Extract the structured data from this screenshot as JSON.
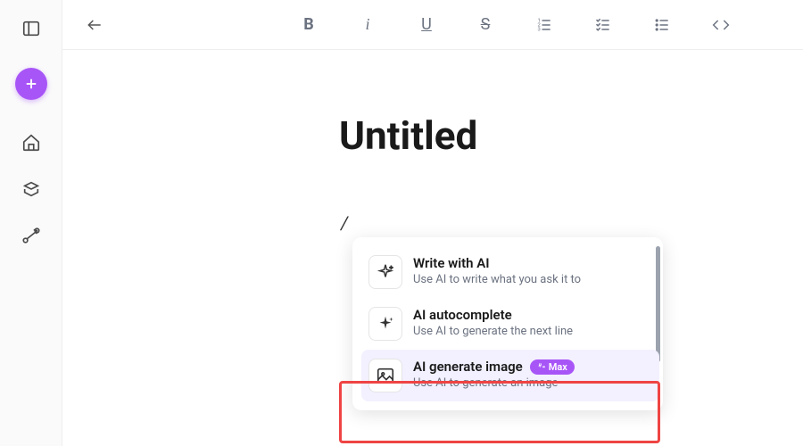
{
  "document": {
    "title": "Untitled",
    "slash_trigger": "/"
  },
  "menu": {
    "items": [
      {
        "title": "Write with AI",
        "desc": "Use AI to write what you ask it to",
        "icon": "sparkle-outline"
      },
      {
        "title": "AI autocomplete",
        "desc": "Use AI to generate the next line",
        "icon": "sparkle-filled"
      },
      {
        "title": "AI generate image",
        "desc": "Use AI to generate an image",
        "icon": "image",
        "badge": "Max",
        "highlighted": true
      }
    ]
  },
  "toolbar": {
    "bold": "B",
    "italic": "i",
    "underline": "U",
    "strike": "S"
  }
}
